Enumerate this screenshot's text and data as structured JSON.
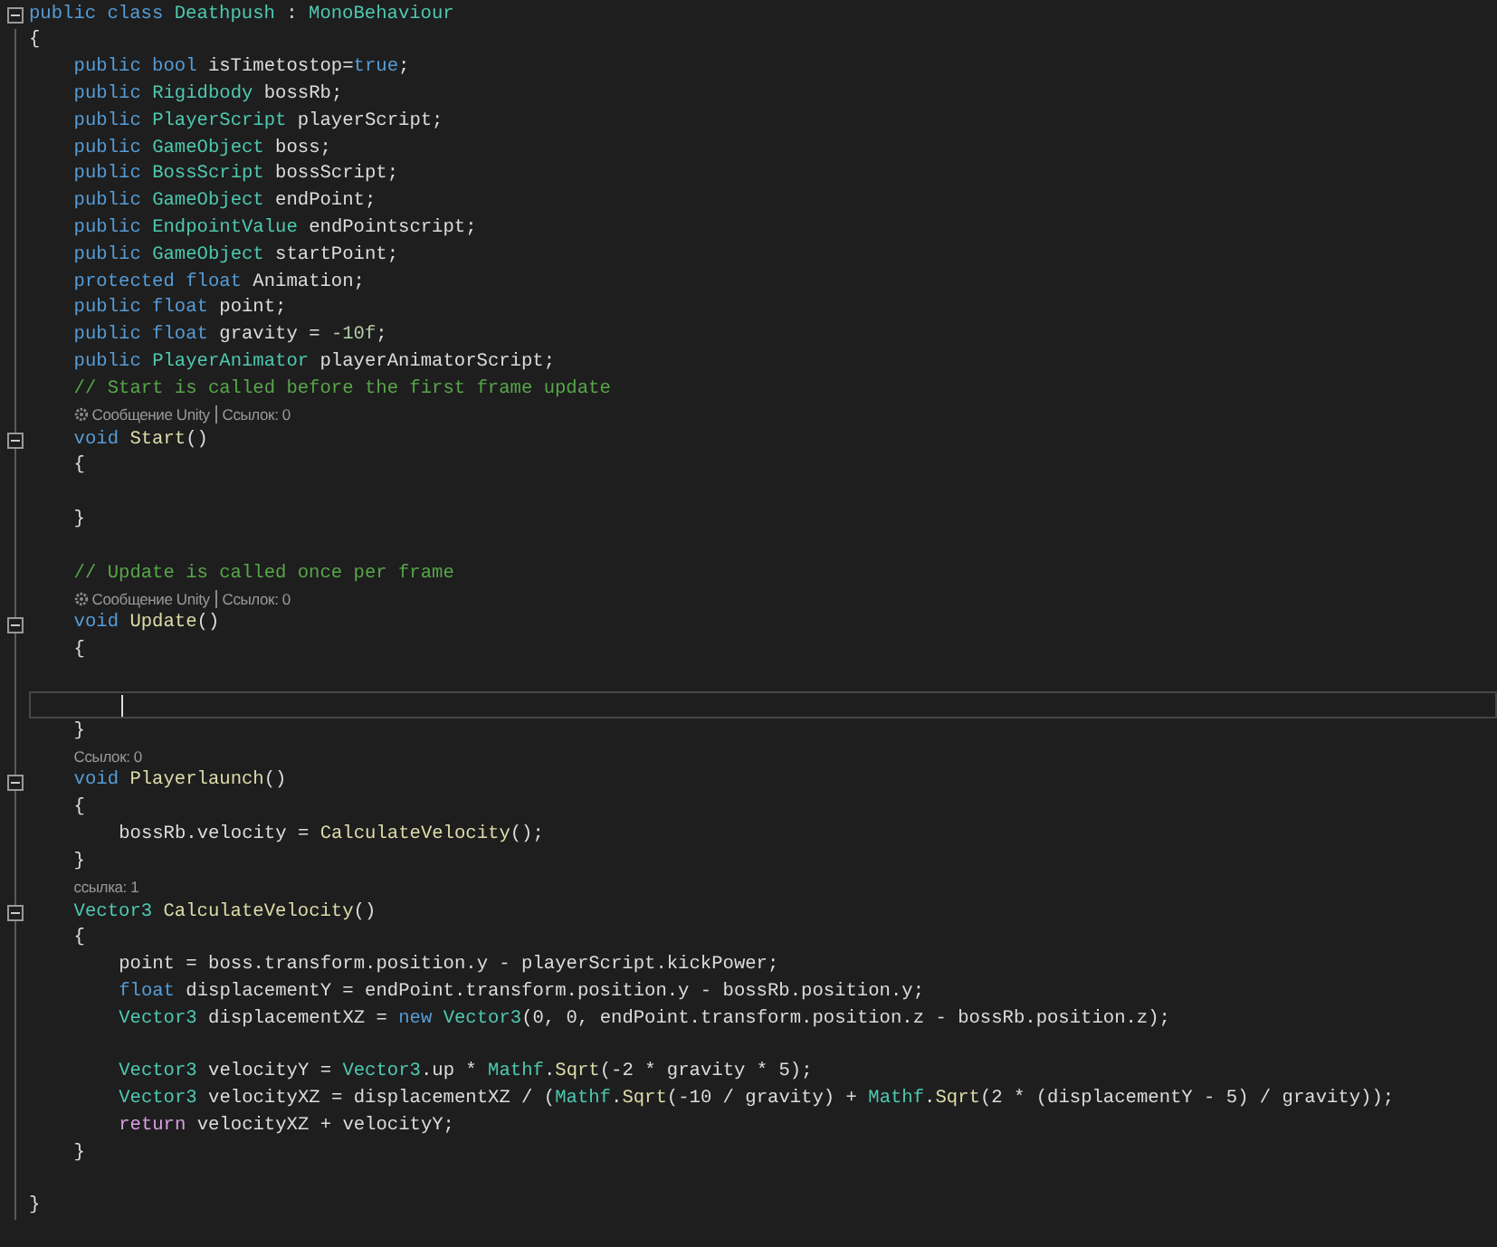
{
  "editor": {
    "lines": [
      {
        "kind": "code",
        "fold": true,
        "current": false,
        "tokens": [
          {
            "kind": "kw",
            "text": "public class "
          },
          {
            "kind": "type",
            "text": "Deathpush"
          },
          {
            "kind": "plain",
            "text": " : "
          },
          {
            "kind": "type",
            "text": "MonoBehaviour"
          }
        ]
      },
      {
        "kind": "code",
        "fold": false,
        "current": false,
        "tokens": [
          {
            "kind": "plain",
            "text": "{"
          }
        ],
        "children": [
          {
            "kind": "code",
            "fold": false,
            "current": false,
            "tokens": [
              {
                "kind": "kw",
                "text": "public bool "
              },
              {
                "kind": "plain",
                "text": "isTimetostop="
              },
              {
                "kind": "kw",
                "text": "true"
              },
              {
                "kind": "plain",
                "text": ";"
              }
            ]
          },
          {
            "kind": "code",
            "fold": false,
            "current": false,
            "tokens": [
              {
                "kind": "kw",
                "text": "public "
              },
              {
                "kind": "type",
                "text": "Rigidbody"
              },
              {
                "kind": "plain",
                "text": " bossRb;"
              }
            ]
          },
          {
            "kind": "code",
            "fold": false,
            "current": false,
            "tokens": [
              {
                "kind": "kw",
                "text": "public "
              },
              {
                "kind": "type",
                "text": "PlayerScript"
              },
              {
                "kind": "plain",
                "text": " playerScript;"
              }
            ]
          },
          {
            "kind": "code",
            "fold": false,
            "current": false,
            "tokens": [
              {
                "kind": "kw",
                "text": "public "
              },
              {
                "kind": "type",
                "text": "GameObject"
              },
              {
                "kind": "plain",
                "text": " boss;"
              }
            ]
          },
          {
            "kind": "code",
            "fold": false,
            "current": false,
            "tokens": [
              {
                "kind": "kw",
                "text": "public "
              },
              {
                "kind": "type",
                "text": "BossScript"
              },
              {
                "kind": "plain",
                "text": " bossScript;"
              }
            ]
          },
          {
            "kind": "code",
            "fold": false,
            "current": false,
            "tokens": [
              {
                "kind": "kw",
                "text": "public "
              },
              {
                "kind": "type",
                "text": "GameObject"
              },
              {
                "kind": "plain",
                "text": " endPoint;"
              }
            ]
          },
          {
            "kind": "code",
            "fold": false,
            "current": false,
            "tokens": [
              {
                "kind": "kw",
                "text": "public "
              },
              {
                "kind": "type",
                "text": "EndpointValue"
              },
              {
                "kind": "plain",
                "text": " endPointscript;"
              }
            ]
          },
          {
            "kind": "code",
            "fold": false,
            "current": false,
            "tokens": [
              {
                "kind": "kw",
                "text": "public "
              },
              {
                "kind": "type",
                "text": "GameObject"
              },
              {
                "kind": "plain",
                "text": " startPoint;"
              }
            ]
          },
          {
            "kind": "code",
            "fold": false,
            "current": false,
            "tokens": [
              {
                "kind": "kw",
                "text": "protected float "
              },
              {
                "kind": "plain",
                "text": "Animation;"
              }
            ]
          },
          {
            "kind": "code",
            "fold": false,
            "current": false,
            "tokens": [
              {
                "kind": "kw",
                "text": "public float "
              },
              {
                "kind": "plain",
                "text": "point;"
              }
            ]
          },
          {
            "kind": "code",
            "fold": false,
            "current": false,
            "tokens": [
              {
                "kind": "kw",
                "text": "public float "
              },
              {
                "kind": "plain",
                "text": "gravity = "
              },
              {
                "kind": "num",
                "text": "-10f"
              },
              {
                "kind": "plain",
                "text": ";"
              }
            ]
          },
          {
            "kind": "code",
            "fold": false,
            "current": false,
            "tokens": [
              {
                "kind": "kw",
                "text": "public "
              },
              {
                "kind": "type",
                "text": "PlayerAnimator"
              },
              {
                "kind": "plain",
                "text": " playerAnimatorScript;"
              }
            ]
          },
          {
            "kind": "code",
            "fold": false,
            "current": false,
            "tokens": [
              {
                "kind": "comment",
                "text": "// Start is called before the first frame update"
              }
            ]
          },
          {
            "kind": "lens",
            "fold": false,
            "current": false,
            "items": [
              {
                "text": "Сообщение Unity",
                "icon": true
              },
              {
                "text": "Ссылок: 0",
                "icon": false
              }
            ]
          },
          {
            "kind": "code",
            "fold": true,
            "current": false,
            "tokens": [
              {
                "kind": "kw",
                "text": "void "
              },
              {
                "kind": "method",
                "text": "Start"
              },
              {
                "kind": "plain",
                "text": "()"
              }
            ]
          },
          {
            "kind": "code",
            "fold": false,
            "current": false,
            "tokens": [
              {
                "kind": "plain",
                "text": "{"
              }
            ],
            "children": [
              {
                "kind": "blank",
                "fold": false,
                "current": false
              }
            ]
          },
          {
            "kind": "code",
            "fold": false,
            "current": false,
            "tokens": [
              {
                "kind": "plain",
                "text": "}"
              }
            ]
          },
          {
            "kind": "blank",
            "fold": false,
            "current": false
          },
          {
            "kind": "code",
            "fold": false,
            "current": false,
            "tokens": [
              {
                "kind": "comment",
                "text": "// Update is called once per frame"
              }
            ]
          },
          {
            "kind": "lens",
            "fold": false,
            "current": false,
            "items": [
              {
                "text": "Сообщение Unity",
                "icon": true
              },
              {
                "text": "Ссылок: 0",
                "icon": false
              }
            ]
          },
          {
            "kind": "code",
            "fold": true,
            "current": false,
            "tokens": [
              {
                "kind": "kw",
                "text": "void "
              },
              {
                "kind": "method",
                "text": "Update"
              },
              {
                "kind": "plain",
                "text": "()"
              }
            ]
          },
          {
            "kind": "code",
            "fold": false,
            "current": false,
            "tokens": [
              {
                "kind": "plain",
                "text": "{"
              }
            ],
            "children": [
              {
                "kind": "blank",
                "fold": false,
                "current": false
              },
              {
                "kind": "blank",
                "fold": false,
                "current": true
              }
            ]
          },
          {
            "kind": "code",
            "fold": false,
            "current": false,
            "tokens": [
              {
                "kind": "plain",
                "text": "}"
              }
            ]
          },
          {
            "kind": "lens",
            "fold": false,
            "current": false,
            "items": [
              {
                "text": "Ссылок: 0",
                "icon": false
              }
            ]
          },
          {
            "kind": "code",
            "fold": true,
            "current": false,
            "tokens": [
              {
                "kind": "kw",
                "text": "void "
              },
              {
                "kind": "method",
                "text": "Playerlaunch"
              },
              {
                "kind": "plain",
                "text": "()"
              }
            ]
          },
          {
            "kind": "code",
            "fold": false,
            "current": false,
            "tokens": [
              {
                "kind": "plain",
                "text": "{"
              }
            ],
            "children": [
              {
                "kind": "code",
                "fold": false,
                "current": false,
                "tokens": [
                  {
                    "kind": "plain",
                    "text": "bossRb.velocity = "
                  },
                  {
                    "kind": "method",
                    "text": "CalculateVelocity"
                  },
                  {
                    "kind": "plain",
                    "text": "();"
                  }
                ]
              }
            ]
          },
          {
            "kind": "code",
            "fold": false,
            "current": false,
            "tokens": [
              {
                "kind": "plain",
                "text": "}"
              }
            ]
          },
          {
            "kind": "lens",
            "fold": false,
            "current": false,
            "items": [
              {
                "text": "ссылка: 1",
                "icon": false
              }
            ]
          },
          {
            "kind": "code",
            "fold": true,
            "current": false,
            "tokens": [
              {
                "kind": "type",
                "text": "Vector3 "
              },
              {
                "kind": "method",
                "text": "CalculateVelocity"
              },
              {
                "kind": "plain",
                "text": "()"
              }
            ]
          },
          {
            "kind": "code",
            "fold": false,
            "current": false,
            "tokens": [
              {
                "kind": "plain",
                "text": "{"
              }
            ],
            "children": [
              {
                "kind": "code",
                "fold": false,
                "current": false,
                "tokens": [
                  {
                    "kind": "plain",
                    "text": "point = boss.transform.position.y - playerScript.kickPower;"
                  }
                ]
              },
              {
                "kind": "code",
                "fold": false,
                "current": false,
                "tokens": [
                  {
                    "kind": "kw",
                    "text": "float "
                  },
                  {
                    "kind": "plain",
                    "text": "displacementY = endPoint.transform.position.y - bossRb.position.y;"
                  }
                ]
              },
              {
                "kind": "code",
                "fold": false,
                "current": false,
                "tokens": [
                  {
                    "kind": "type",
                    "text": "Vector3"
                  },
                  {
                    "kind": "plain",
                    "text": " displacementXZ = "
                  },
                  {
                    "kind": "kw",
                    "text": "new "
                  },
                  {
                    "kind": "type",
                    "text": "Vector3"
                  },
                  {
                    "kind": "plain",
                    "text": "(0, 0, endPoint.transform.position.z - bossRb.position.z);"
                  }
                ]
              },
              {
                "kind": "blank",
                "fold": false,
                "current": false
              },
              {
                "kind": "code",
                "fold": false,
                "current": false,
                "tokens": [
                  {
                    "kind": "type",
                    "text": "Vector3"
                  },
                  {
                    "kind": "plain",
                    "text": " velocityY = "
                  },
                  {
                    "kind": "type",
                    "text": "Vector3"
                  },
                  {
                    "kind": "plain",
                    "text": ".up * "
                  },
                  {
                    "kind": "type",
                    "text": "Mathf"
                  },
                  {
                    "kind": "plain",
                    "text": "."
                  },
                  {
                    "kind": "method",
                    "text": "Sqrt"
                  },
                  {
                    "kind": "plain",
                    "text": "(-2 * gravity * 5);"
                  }
                ]
              },
              {
                "kind": "code",
                "fold": false,
                "current": false,
                "tokens": [
                  {
                    "kind": "type",
                    "text": "Vector3"
                  },
                  {
                    "kind": "plain",
                    "text": " velocityXZ = displacementXZ / ("
                  },
                  {
                    "kind": "type",
                    "text": "Mathf"
                  },
                  {
                    "kind": "plain",
                    "text": "."
                  },
                  {
                    "kind": "method",
                    "text": "Sqrt"
                  },
                  {
                    "kind": "plain",
                    "text": "(-10 / gravity) + "
                  },
                  {
                    "kind": "type",
                    "text": "Mathf"
                  },
                  {
                    "kind": "plain",
                    "text": "."
                  },
                  {
                    "kind": "method",
                    "text": "Sqrt"
                  },
                  {
                    "kind": "plain",
                    "text": "(2 * (displacementY - 5) / gravity));"
                  }
                ]
              },
              {
                "kind": "code",
                "fold": false,
                "current": false,
                "tokens": [
                  {
                    "kind": "ctrl",
                    "text": "return "
                  },
                  {
                    "kind": "plain",
                    "text": "velocityXZ + velocityY;"
                  }
                ]
              }
            ]
          },
          {
            "kind": "code",
            "fold": false,
            "current": false,
            "tokens": [
              {
                "kind": "plain",
                "text": "}"
              }
            ]
          },
          {
            "kind": "blank",
            "fold": false,
            "current": false
          }
        ]
      },
      {
        "kind": "code",
        "fold": false,
        "current": false,
        "tokens": [
          {
            "kind": "plain",
            "text": "}"
          }
        ]
      }
    ]
  }
}
